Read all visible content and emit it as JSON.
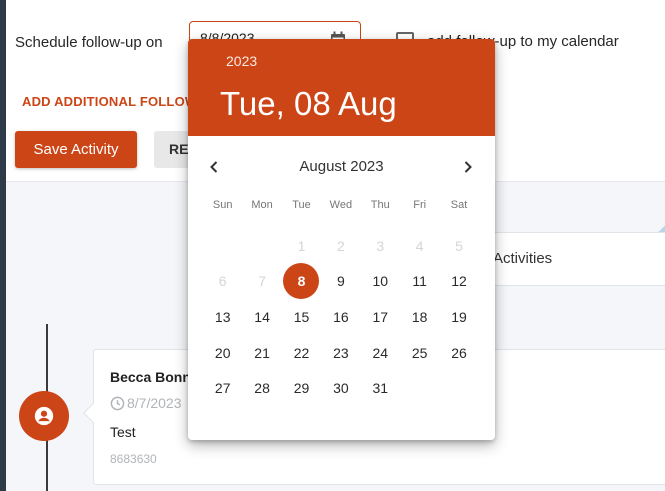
{
  "form": {
    "schedule_label": "Schedule follow-up on",
    "date_value": "8/8/2023",
    "calendar_checkbox_label": "add follow-up to my calendar",
    "add_link": "ADD ADDITIONAL FOLLOW",
    "save_label": "Save Activity",
    "reset_label": "RESET"
  },
  "activities": {
    "label": "Activities"
  },
  "entry": {
    "name": "Becca Bonner",
    "date": "8/7/2023",
    "text": "Test",
    "id": "8683630"
  },
  "picker": {
    "year": "2023",
    "selected_display": "Tue, 08 Aug",
    "month_label": "August 2023",
    "weekdays": [
      "Sun",
      "Mon",
      "Tue",
      "Wed",
      "Thu",
      "Fri",
      "Sat"
    ],
    "weeks": [
      [
        "",
        "",
        "1",
        "2",
        "3",
        "4",
        "5"
      ],
      [
        "6",
        "7",
        "8",
        "9",
        "10",
        "11",
        "12"
      ],
      [
        "13",
        "14",
        "15",
        "16",
        "17",
        "18",
        "19"
      ],
      [
        "20",
        "21",
        "22",
        "23",
        "24",
        "25",
        "26"
      ],
      [
        "27",
        "28",
        "29",
        "30",
        "31",
        "",
        ""
      ]
    ],
    "disabled_days": [
      "1",
      "2",
      "3",
      "4",
      "5",
      "6",
      "7"
    ],
    "selected_day": "8"
  },
  "colors": {
    "accent": "#cc4516",
    "page_bg": "#2f3a48",
    "info_diamond": "#b7d6ea"
  }
}
